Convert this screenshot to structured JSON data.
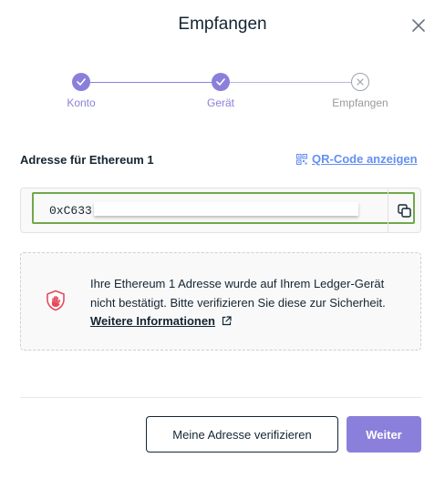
{
  "modal": {
    "title": "Empfangen",
    "close_icon": "close-icon"
  },
  "stepper": {
    "steps": [
      {
        "label": "Konto",
        "state": "done"
      },
      {
        "label": "Gerät",
        "state": "done"
      },
      {
        "label": "Empfangen",
        "state": "pending"
      }
    ],
    "accent_color": "#8a80db"
  },
  "address": {
    "title": "Adresse für Ethereum 1",
    "qr_link": "QR-Code anzeigen",
    "qr_icon": "qr-code-icon",
    "value_prefix": "0xC633",
    "copy_icon": "copy-icon",
    "highlight_color": "#6fa84a"
  },
  "warning": {
    "icon": "shield-hand-icon",
    "text": "Ihre Ethereum 1 Adresse wurde auf Ihrem Ledger-Gerät nicht bestätigt. Bitte verifizieren Sie diese zur Sicherheit.",
    "link": "Weitere Informationen",
    "link_icon": "external-link-icon"
  },
  "footer": {
    "verify_button": "Meine Adresse verifizieren",
    "next_button": "Weiter"
  }
}
